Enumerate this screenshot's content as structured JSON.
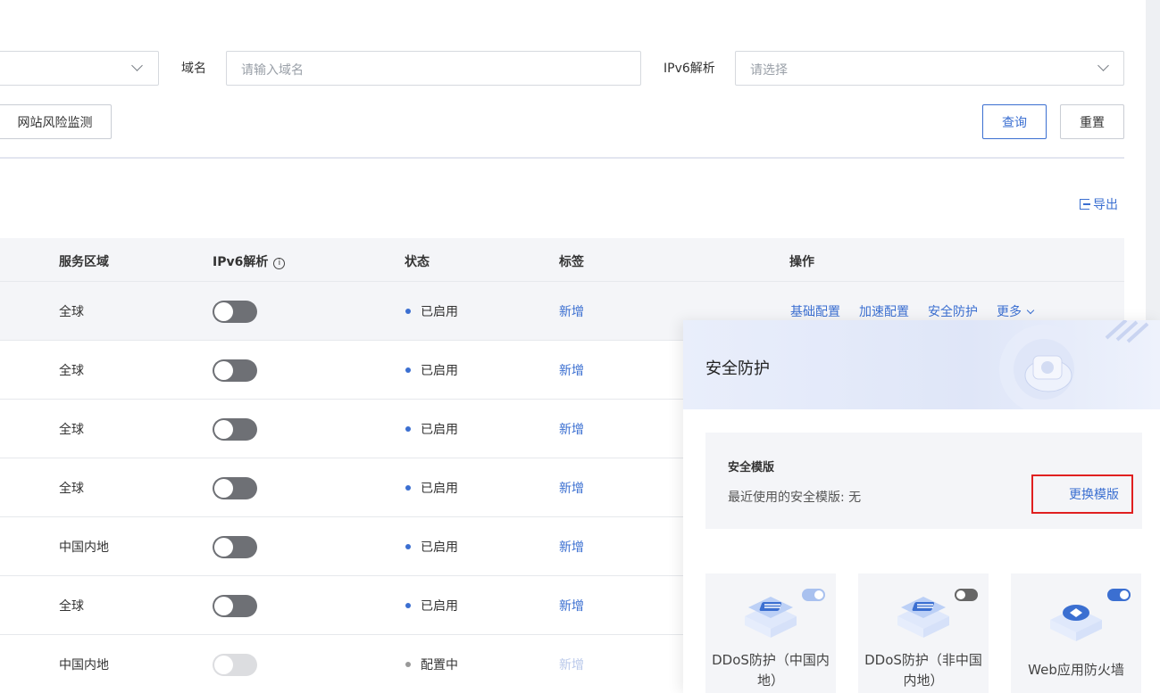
{
  "filters": {
    "domain_label": "域名",
    "domain_placeholder": "请输入域名",
    "ipv6_label": "IPv6解析",
    "ipv6_placeholder": "请选择",
    "risk_monitor_label": "网站风险监测",
    "query_label": "查询",
    "reset_label": "重置"
  },
  "export_label": "导出",
  "table": {
    "headers": {
      "region": "服务区域",
      "ipv6": "IPv6解析",
      "status": "状态",
      "tags": "标签",
      "actions": "操作"
    },
    "rows": [
      {
        "region": "全球",
        "ipv6_enabled": false,
        "status": "已启用",
        "status_color": "#3b6fd1",
        "tag": "新增"
      },
      {
        "region": "全球",
        "ipv6_enabled": false,
        "status": "已启用",
        "status_color": "#3b6fd1",
        "tag": "新增"
      },
      {
        "region": "全球",
        "ipv6_enabled": false,
        "status": "已启用",
        "status_color": "#3b6fd1",
        "tag": "新增"
      },
      {
        "region": "全球",
        "ipv6_enabled": false,
        "status": "已启用",
        "status_color": "#3b6fd1",
        "tag": "新增"
      },
      {
        "region": "中国内地",
        "ipv6_enabled": false,
        "status": "已启用",
        "status_color": "#3b6fd1",
        "tag": "新增"
      },
      {
        "region": "全球",
        "ipv6_enabled": false,
        "status": "已启用",
        "status_color": "#3b6fd1",
        "tag": "新增"
      },
      {
        "region": "中国内地",
        "ipv6_enabled": false,
        "ipv6_disabled": true,
        "status": "配置中",
        "status_color": "#999999",
        "tag": "新增"
      }
    ],
    "row_actions": {
      "basic_config": "基础配置",
      "accel_config": "加速配置",
      "security": "安全防护",
      "more": "更多"
    }
  },
  "security_panel": {
    "title": "安全防护",
    "template_title": "安全模版",
    "recent_template": "最近使用的安全模版: 无",
    "change_template": "更换模版",
    "cards": [
      {
        "label": "DDoS防护（中国内地）",
        "toggle": "on-light"
      },
      {
        "label": "DDoS防护（非中国内地）",
        "toggle": "off"
      },
      {
        "label": "Web应用防火墙",
        "toggle": "on"
      }
    ]
  },
  "colors": {
    "accent": "#3b6fd1",
    "highlight_border": "#e02020"
  }
}
